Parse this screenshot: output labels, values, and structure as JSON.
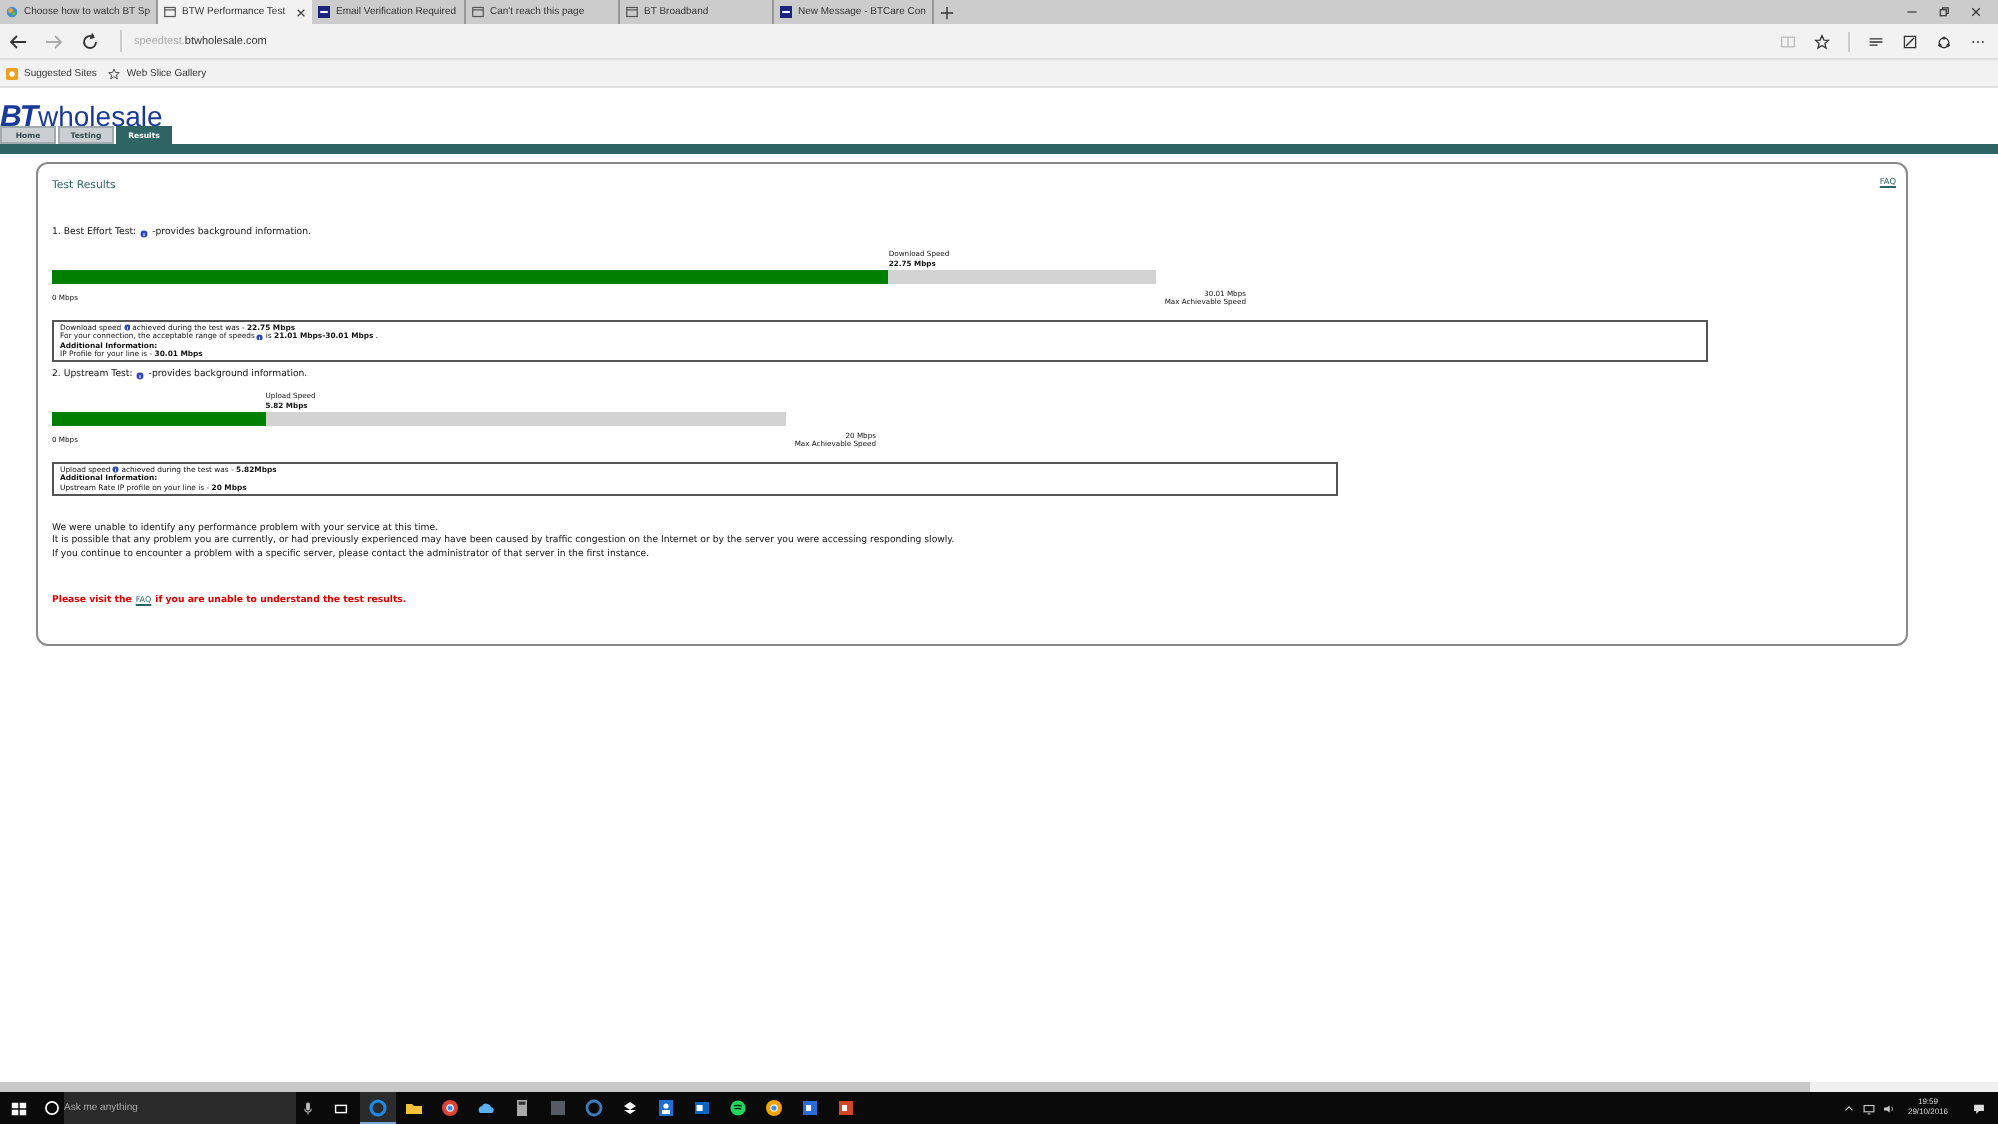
{
  "browser": {
    "tabs": [
      {
        "label": "Choose how to watch BT Sp",
        "selected": false,
        "kind": "colorful"
      },
      {
        "label": "BTW Performance Test",
        "selected": true,
        "kind": "page"
      },
      {
        "label": "Email Verification Required",
        "selected": false,
        "kind": "bt"
      },
      {
        "label": "Can't reach this page",
        "selected": false,
        "kind": "page"
      },
      {
        "label": "BT Broadband",
        "selected": false,
        "kind": "page"
      },
      {
        "label": "New Message - BTCare Con",
        "selected": false,
        "kind": "bt"
      }
    ],
    "address": {
      "subdomain": "speedtest.",
      "domain": "btwholesale.com"
    },
    "favorites": [
      {
        "label": "Suggested Sites",
        "kind": "orange"
      },
      {
        "label": "Web Slice Gallery",
        "kind": "star"
      }
    ]
  },
  "site": {
    "logo": {
      "mark": "BT",
      "name": "wholesale"
    },
    "nav": [
      {
        "label": "Home",
        "selected": false
      },
      {
        "label": "Testing",
        "selected": false
      },
      {
        "label": "Results",
        "selected": true
      }
    ],
    "faq": "FAQ",
    "title": "Test Results",
    "tests": [
      {
        "heading": "1. Best Effort Test:",
        "note": "-provides background information.",
        "speed_label": "Download Speed",
        "speed": "22.75 Mbps",
        "level": 0.758,
        "min": "0 Mbps",
        "max": "30.01 Mbps",
        "max_label": "Max Achievable Speed",
        "info": [
          {
            "kind": "icon",
            "lead": "Download speed",
            "text": "achieved during the test was - **22.75 Mbps**"
          },
          {
            "kind": "icon",
            "lead": "For your connection, the acceptable range of speeds",
            "text": "is **21.01 Mbps-30.01 Mbps** ."
          },
          {
            "kind": "heading",
            "text": "Additional Information:"
          },
          {
            "kind": "plain",
            "text": "IP Profile for your line is - **30.01 Mbps**"
          }
        ]
      },
      {
        "heading": "2. Upstream Test:",
        "note": "-provides background information.",
        "speed_label": "Upload Speed",
        "speed": "5.82 Mbps",
        "level": 0.291,
        "min": "0 Mbps",
        "max": "20 Mbps",
        "max_label": "Max Achievable Speed",
        "info": [
          {
            "kind": "icon",
            "lead": "Upload speed",
            "text": "achieved during the test was - **5.82Mbps**"
          },
          {
            "kind": "heading",
            "text": "Additional Information:"
          },
          {
            "kind": "plain",
            "text": "Upstream Rate IP profile on your line is - **20 Mbps**"
          }
        ]
      }
    ],
    "summary": [
      "We were unable to identify any performance problem with your service at this time.",
      "It is possible that any problem you are currently, or had previously experienced may have been caused by traffic congestion on the Internet or by the server you were accessing responding slowly.",
      "If you continue to encounter a problem with a specific server, please contact the administrator of that server in the first instance."
    ],
    "help": {
      "before": "Please visit the",
      "link": "FAQ",
      "after": "if you are unable to understand the test results."
    }
  },
  "taskbar": {
    "search_placeholder": "Ask me anything",
    "time": "19:59",
    "date": "29/10/2016"
  }
}
